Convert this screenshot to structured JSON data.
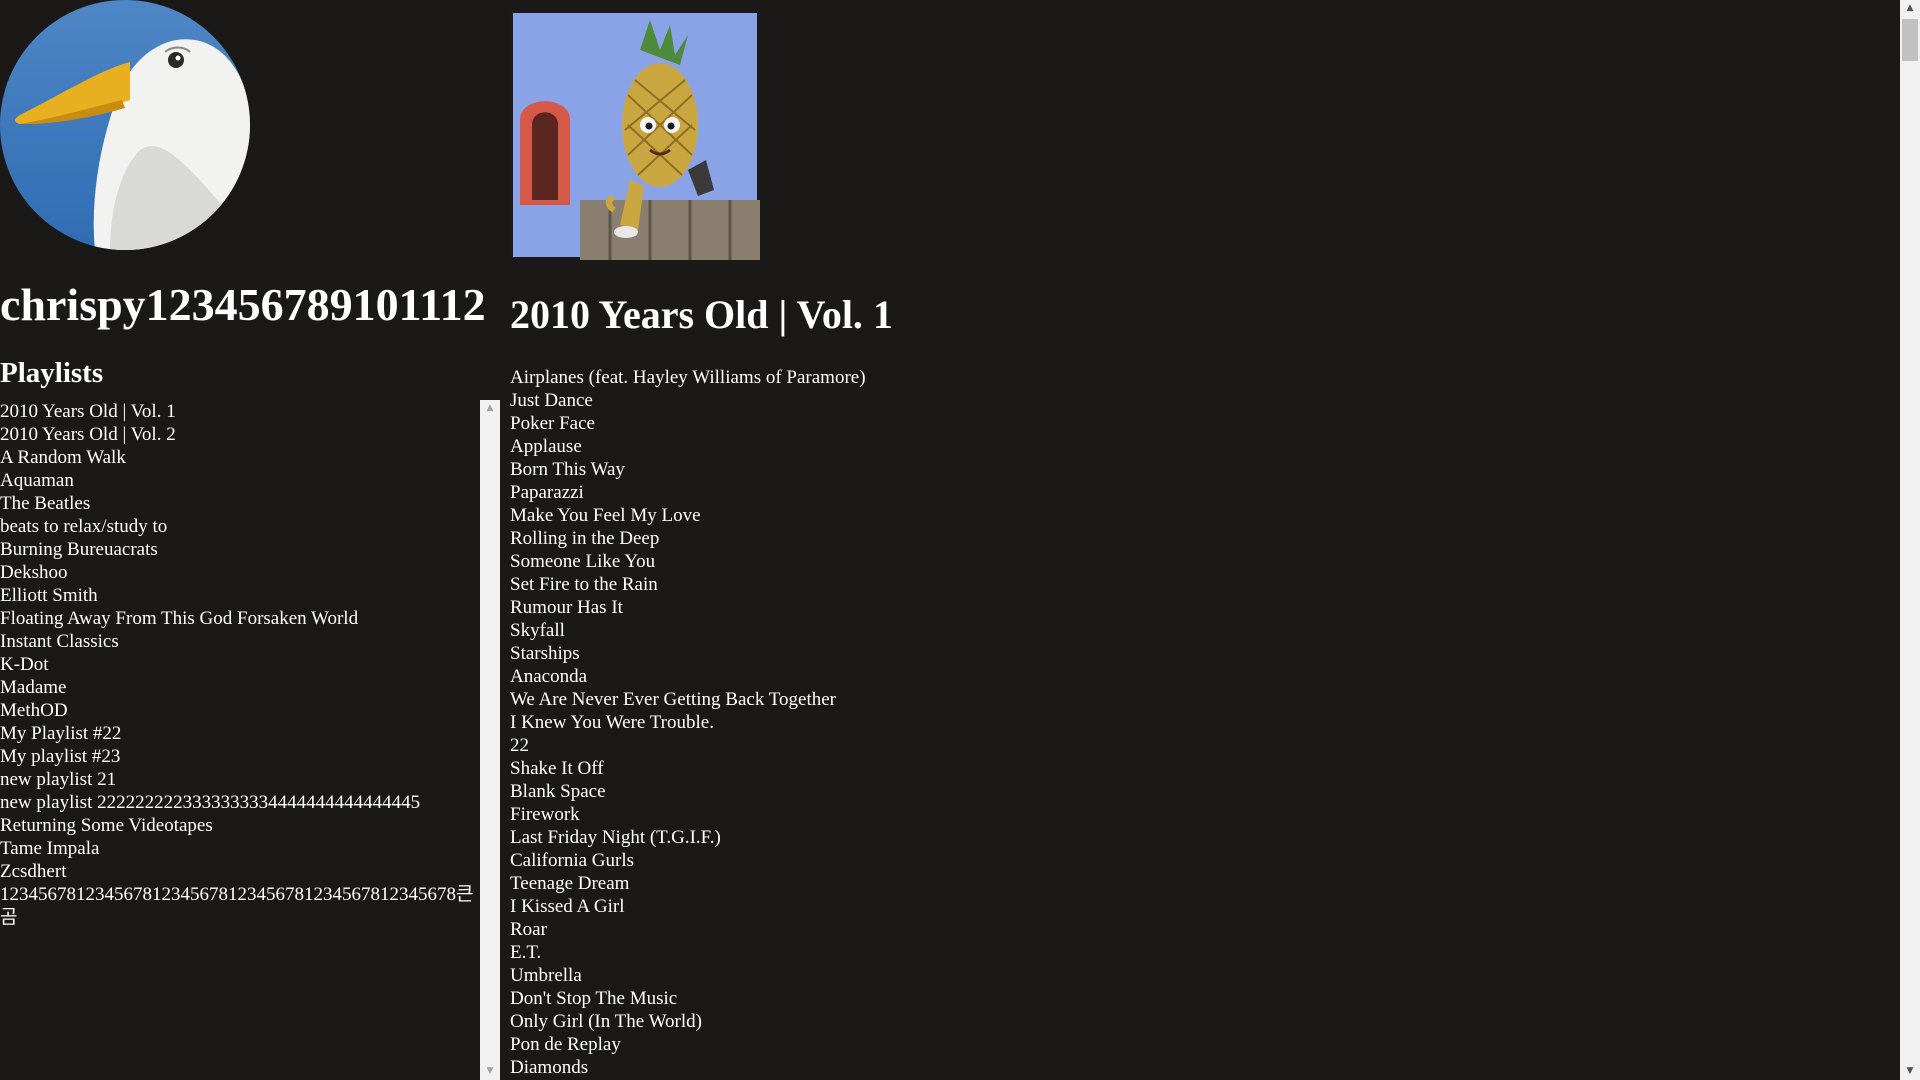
{
  "profile": {
    "username": "chrispy123456789101112",
    "avatar_icon": "seagull-avatar-image"
  },
  "sidebar": {
    "heading": "Playlists",
    "playlists": [
      "2010 Years Old | Vol. 1",
      "2010 Years Old | Vol. 2",
      "A Random Walk",
      "Aquaman",
      "The Beatles",
      "beats to relax/study to",
      "Burning Bureuacrats",
      "Dekshoo",
      "Elliott Smith",
      "Floating Away From This God Forsaken World",
      "Instant Classics",
      "K-Dot",
      "Madame",
      "MethOD",
      "My Playlist #22",
      "My playlist #23",
      "new playlist 21",
      "new playlist 2222222223333333334444444444444445",
      "Returning Some Videotapes",
      "Tame Impala",
      "Zcsdhert",
      "123456781234567812345678123456781234567812345678큰 곰"
    ]
  },
  "main": {
    "cover_icon": "pineapple-puppet-cover-image",
    "playlist_title": "2010 Years Old | Vol. 1",
    "tracks": [
      "Airplanes (feat. Hayley Williams of Paramore)",
      "Just Dance",
      "Poker Face",
      "Applause",
      "Born This Way",
      "Paparazzi",
      "Make You Feel My Love",
      "Rolling in the Deep",
      "Someone Like You",
      "Set Fire to the Rain",
      "Rumour Has It",
      "Skyfall",
      "Starships",
      "Anaconda",
      "We Are Never Ever Getting Back Together",
      "I Knew You Were Trouble.",
      "22",
      "Shake It Off",
      "Blank Space",
      "Firework",
      "Last Friday Night (T.G.I.F.)",
      "California Gurls",
      "Teenage Dream",
      "I Kissed A Girl",
      "Roar",
      "E.T.",
      "Umbrella",
      "Don't Stop The Music",
      "Only Girl (In The World)",
      "Pon de Replay",
      "Diamonds"
    ]
  },
  "colors": {
    "background": "#1b1818",
    "text": "#ffffff",
    "scrollbar_track": "#f1f1f1",
    "scrollbar_thumb": "#c1c1c1"
  }
}
